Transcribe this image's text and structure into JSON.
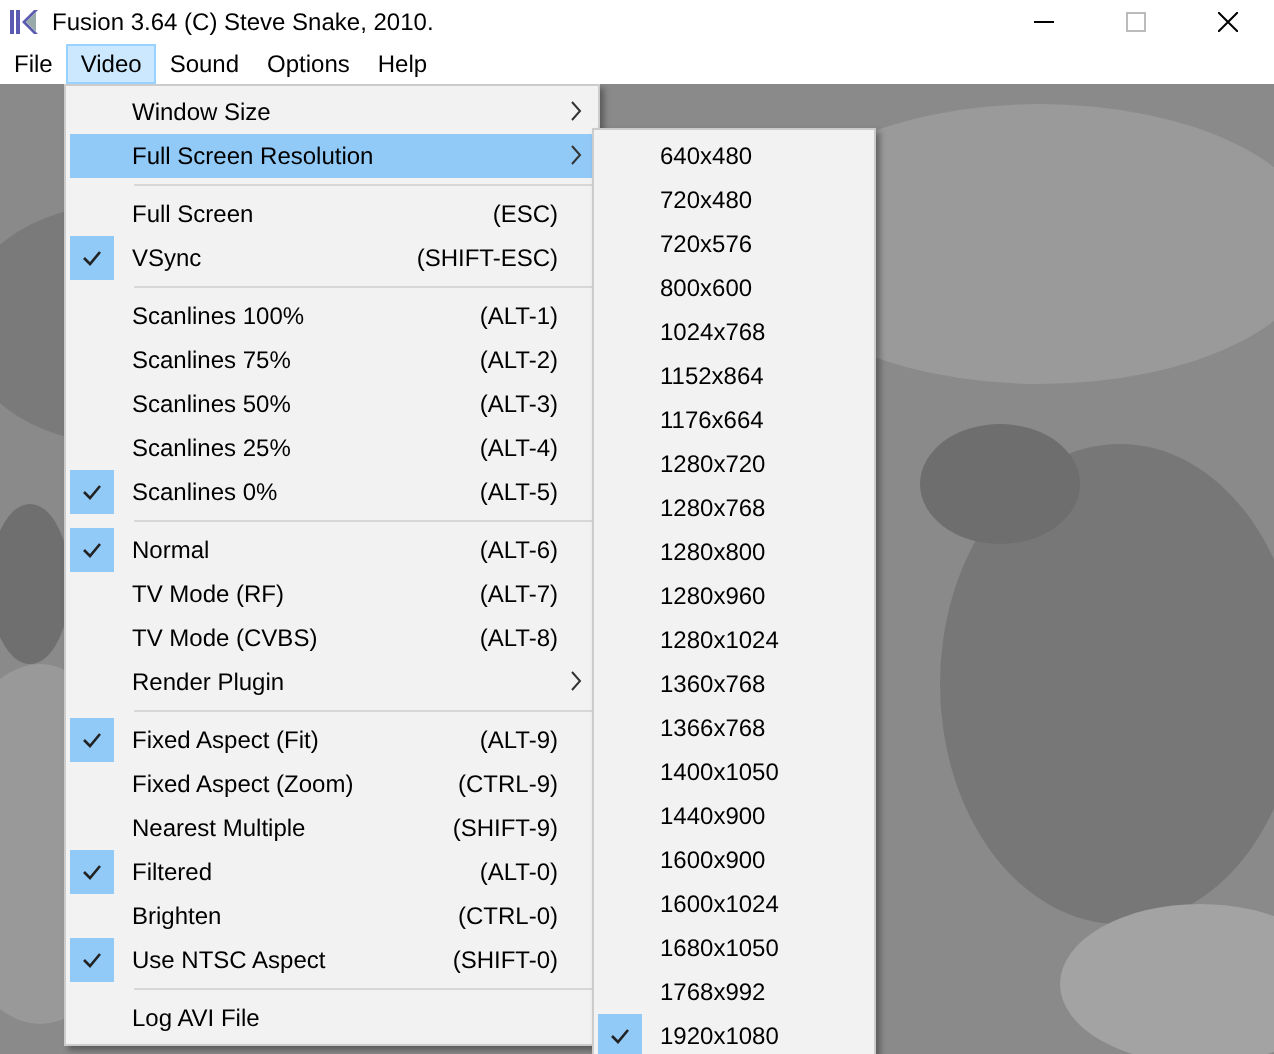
{
  "window": {
    "title": "Fusion 3.64 (C) Steve Snake, 2010."
  },
  "menu_bar": [
    {
      "label": "File",
      "selected": false
    },
    {
      "label": "Video",
      "selected": true
    },
    {
      "label": "Sound",
      "selected": false
    },
    {
      "label": "Options",
      "selected": false
    },
    {
      "label": "Help",
      "selected": false
    }
  ],
  "video_menu": {
    "items": [
      {
        "kind": "item",
        "label": "Window Size",
        "checked": false,
        "submenu": true,
        "selected": false
      },
      {
        "kind": "item",
        "label": "Full Screen Resolution",
        "checked": false,
        "submenu": true,
        "selected": true
      },
      {
        "kind": "separator"
      },
      {
        "kind": "item",
        "label": "Full Screen",
        "shortcut": "(ESC)",
        "checked": false,
        "selected": false
      },
      {
        "kind": "item",
        "label": "VSync",
        "shortcut": "(SHIFT-ESC)",
        "checked": true,
        "selected": false
      },
      {
        "kind": "separator"
      },
      {
        "kind": "item",
        "label": "Scanlines 100%",
        "shortcut": "(ALT-1)",
        "checked": false,
        "selected": false
      },
      {
        "kind": "item",
        "label": "Scanlines 75%",
        "shortcut": "(ALT-2)",
        "checked": false,
        "selected": false
      },
      {
        "kind": "item",
        "label": "Scanlines 50%",
        "shortcut": "(ALT-3)",
        "checked": false,
        "selected": false
      },
      {
        "kind": "item",
        "label": "Scanlines 25%",
        "shortcut": "(ALT-4)",
        "checked": false,
        "selected": false
      },
      {
        "kind": "item",
        "label": "Scanlines 0%",
        "shortcut": "(ALT-5)",
        "checked": true,
        "selected": false
      },
      {
        "kind": "separator"
      },
      {
        "kind": "item",
        "label": "Normal",
        "shortcut": "(ALT-6)",
        "checked": true,
        "selected": false
      },
      {
        "kind": "item",
        "label": "TV Mode (RF)",
        "shortcut": "(ALT-7)",
        "checked": false,
        "selected": false
      },
      {
        "kind": "item",
        "label": "TV Mode (CVBS)",
        "shortcut": "(ALT-8)",
        "checked": false,
        "selected": false
      },
      {
        "kind": "item",
        "label": "Render Plugin",
        "checked": false,
        "submenu": true,
        "selected": false
      },
      {
        "kind": "separator"
      },
      {
        "kind": "item",
        "label": "Fixed Aspect (Fit)",
        "shortcut": "(ALT-9)",
        "checked": true,
        "selected": false
      },
      {
        "kind": "item",
        "label": "Fixed Aspect (Zoom)",
        "shortcut": "(CTRL-9)",
        "checked": false,
        "selected": false
      },
      {
        "kind": "item",
        "label": "Nearest Multiple",
        "shortcut": "(SHIFT-9)",
        "checked": false,
        "selected": false
      },
      {
        "kind": "item",
        "label": "Filtered",
        "shortcut": "(ALT-0)",
        "checked": true,
        "selected": false
      },
      {
        "kind": "item",
        "label": "Brighten",
        "shortcut": "(CTRL-0)",
        "checked": false,
        "selected": false
      },
      {
        "kind": "item",
        "label": "Use NTSC Aspect",
        "shortcut": "(SHIFT-0)",
        "checked": true,
        "selected": false
      },
      {
        "kind": "separator"
      },
      {
        "kind": "item",
        "label": "Log AVI File",
        "checked": false,
        "selected": false
      }
    ]
  },
  "resolution_menu": {
    "items": [
      {
        "label": "640x480",
        "checked": false
      },
      {
        "label": "720x480",
        "checked": false
      },
      {
        "label": "720x576",
        "checked": false
      },
      {
        "label": "800x600",
        "checked": false
      },
      {
        "label": "1024x768",
        "checked": false
      },
      {
        "label": "1152x864",
        "checked": false
      },
      {
        "label": "1176x664",
        "checked": false
      },
      {
        "label": "1280x720",
        "checked": false
      },
      {
        "label": "1280x768",
        "checked": false
      },
      {
        "label": "1280x800",
        "checked": false
      },
      {
        "label": "1280x960",
        "checked": false
      },
      {
        "label": "1280x1024",
        "checked": false
      },
      {
        "label": "1360x768",
        "checked": false
      },
      {
        "label": "1366x768",
        "checked": false
      },
      {
        "label": "1400x1050",
        "checked": false
      },
      {
        "label": "1440x900",
        "checked": false
      },
      {
        "label": "1600x900",
        "checked": false
      },
      {
        "label": "1600x1024",
        "checked": false
      },
      {
        "label": "1680x1050",
        "checked": false
      },
      {
        "label": "1768x992",
        "checked": false
      },
      {
        "label": "1920x1080",
        "checked": true
      }
    ]
  }
}
